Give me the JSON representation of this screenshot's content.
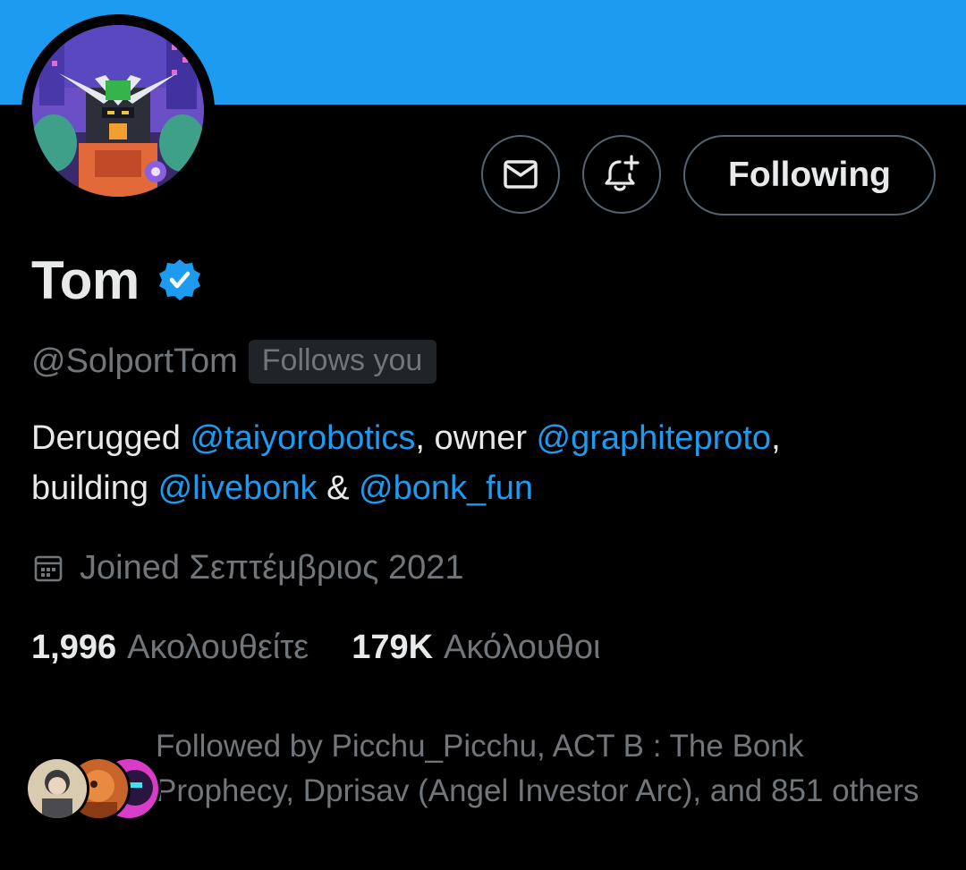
{
  "profile": {
    "display_name": "Tom",
    "handle": "@SolportTom",
    "follows_you_badge": "Follows you",
    "verified": true,
    "avatar_icon": "robot-mecha-avatar"
  },
  "actions": {
    "message_icon": "envelope-icon",
    "notify_icon": "bell-plus-icon",
    "following_label": "Following"
  },
  "bio": {
    "part1": "Derugged ",
    "mention1": "@taiyorobotics",
    "part2": ", owner ",
    "mention2": "@graphiteproto",
    "part3": ",",
    "part4": "building ",
    "mention3": "@livebonk",
    "part5": " & ",
    "mention4": "@bonk_fun"
  },
  "joined": {
    "icon": "calendar-icon",
    "text": "Joined Σεπτέμβριος 2021"
  },
  "stats": {
    "following_count": "1,996",
    "following_label": "Ακολουθείτε",
    "followers_count": "179K",
    "followers_label": "Ακόλουθοι"
  },
  "followed_by": {
    "text": "Followed by Picchu_Picchu, ACT B : The Bonk Prophecy, Dprisav (Angel Investor Arc), and 851 others"
  },
  "colors": {
    "banner": "#1d9bf0",
    "accent": "#1d9bf0",
    "background": "#000000",
    "text": "#e7e9ea",
    "muted": "#71767b",
    "border": "#536471"
  }
}
